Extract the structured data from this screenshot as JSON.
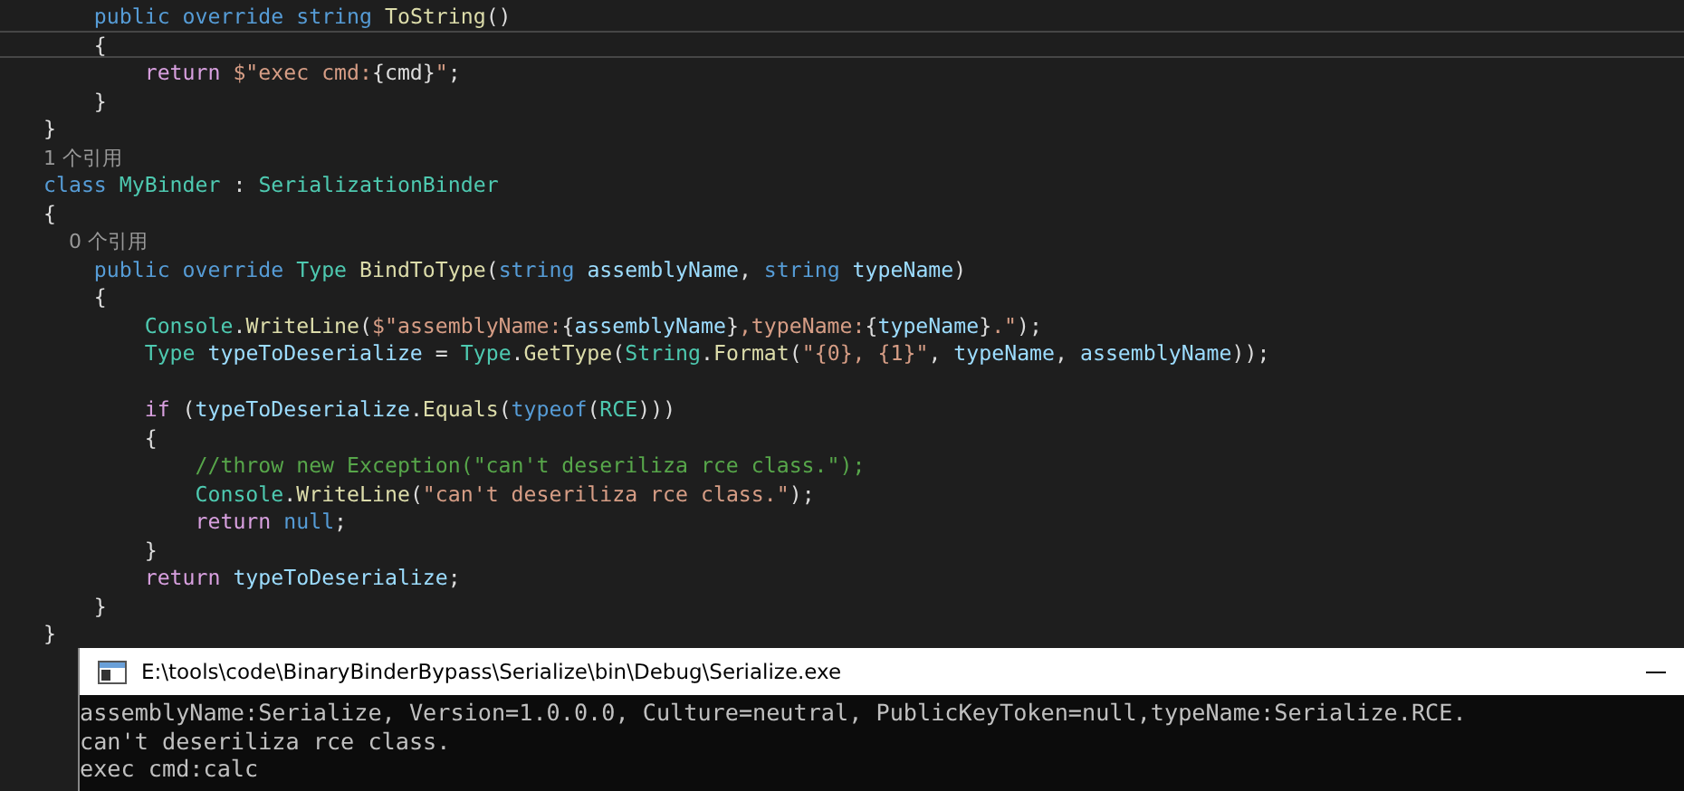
{
  "editor": {
    "lines": [
      {
        "current": false,
        "tokens": [
          {
            "kind": "kw",
            "text": "    public "
          },
          {
            "kind": "kw",
            "text": "override "
          },
          {
            "kind": "kw",
            "text": "string "
          },
          {
            "kind": "method",
            "text": "ToString"
          },
          {
            "kind": "plain",
            "text": "()"
          }
        ]
      },
      {
        "current": true,
        "tokens": [
          {
            "kind": "plain",
            "text": "    {"
          }
        ]
      },
      {
        "current": false,
        "tokens": [
          {
            "kind": "ctrl",
            "text": "        return "
          },
          {
            "kind": "str",
            "text": "$\"exec cmd:"
          },
          {
            "kind": "plain",
            "text": "{cmd}"
          },
          {
            "kind": "str",
            "text": "\""
          },
          {
            "kind": "plain",
            "text": ";"
          }
        ]
      },
      {
        "current": false,
        "tokens": [
          {
            "kind": "plain",
            "text": "    }"
          }
        ]
      },
      {
        "current": false,
        "tokens": [
          {
            "kind": "plain",
            "text": "}"
          }
        ]
      },
      {
        "current": false,
        "tokens": [
          {
            "kind": "lens",
            "text": "1 个引用"
          }
        ]
      },
      {
        "current": false,
        "tokens": [
          {
            "kind": "kw",
            "text": "class "
          },
          {
            "kind": "type",
            "text": "MyBinder"
          },
          {
            "kind": "plain",
            "text": " : "
          },
          {
            "kind": "type",
            "text": "SerializationBinder"
          }
        ]
      },
      {
        "current": false,
        "tokens": [
          {
            "kind": "plain",
            "text": "{"
          }
        ]
      },
      {
        "current": false,
        "tokens": [
          {
            "kind": "lens",
            "text": "    0 个引用"
          }
        ]
      },
      {
        "current": false,
        "tokens": [
          {
            "kind": "kw",
            "text": "    public "
          },
          {
            "kind": "kw",
            "text": "override "
          },
          {
            "kind": "type",
            "text": "Type "
          },
          {
            "kind": "method",
            "text": "BindToType"
          },
          {
            "kind": "plain",
            "text": "("
          },
          {
            "kind": "kw",
            "text": "string "
          },
          {
            "kind": "param",
            "text": "assemblyName"
          },
          {
            "kind": "plain",
            "text": ", "
          },
          {
            "kind": "kw",
            "text": "string "
          },
          {
            "kind": "param",
            "text": "typeName"
          },
          {
            "kind": "plain",
            "text": ")"
          }
        ]
      },
      {
        "current": false,
        "tokens": [
          {
            "kind": "plain",
            "text": "    {"
          }
        ]
      },
      {
        "current": false,
        "tokens": [
          {
            "kind": "type",
            "text": "        Console"
          },
          {
            "kind": "plain",
            "text": "."
          },
          {
            "kind": "method",
            "text": "WriteLine"
          },
          {
            "kind": "plain",
            "text": "("
          },
          {
            "kind": "str",
            "text": "$\"assemblyName:"
          },
          {
            "kind": "plain",
            "text": "{"
          },
          {
            "kind": "param",
            "text": "assemblyName"
          },
          {
            "kind": "plain",
            "text": "}"
          },
          {
            "kind": "str",
            "text": ",typeName:"
          },
          {
            "kind": "plain",
            "text": "{"
          },
          {
            "kind": "param",
            "text": "typeName"
          },
          {
            "kind": "plain",
            "text": "}"
          },
          {
            "kind": "str",
            "text": ".\""
          },
          {
            "kind": "plain",
            "text": ");"
          }
        ]
      },
      {
        "current": false,
        "tokens": [
          {
            "kind": "type",
            "text": "        Type "
          },
          {
            "kind": "param",
            "text": "typeToDeserialize"
          },
          {
            "kind": "plain",
            "text": " = "
          },
          {
            "kind": "type",
            "text": "Type"
          },
          {
            "kind": "plain",
            "text": "."
          },
          {
            "kind": "method",
            "text": "GetType"
          },
          {
            "kind": "plain",
            "text": "("
          },
          {
            "kind": "type",
            "text": "String"
          },
          {
            "kind": "plain",
            "text": "."
          },
          {
            "kind": "method",
            "text": "Format"
          },
          {
            "kind": "plain",
            "text": "("
          },
          {
            "kind": "str",
            "text": "\"{0}, {1}\""
          },
          {
            "kind": "plain",
            "text": ", "
          },
          {
            "kind": "param",
            "text": "typeName"
          },
          {
            "kind": "plain",
            "text": ", "
          },
          {
            "kind": "param",
            "text": "assemblyName"
          },
          {
            "kind": "plain",
            "text": "));"
          }
        ]
      },
      {
        "current": false
      },
      {
        "current": false,
        "tokens": [
          {
            "kind": "ctrl",
            "text": "        if "
          },
          {
            "kind": "plain",
            "text": "("
          },
          {
            "kind": "param",
            "text": "typeToDeserialize"
          },
          {
            "kind": "plain",
            "text": "."
          },
          {
            "kind": "method",
            "text": "Equals"
          },
          {
            "kind": "plain",
            "text": "("
          },
          {
            "kind": "kw",
            "text": "typeof"
          },
          {
            "kind": "plain",
            "text": "("
          },
          {
            "kind": "type",
            "text": "RCE"
          },
          {
            "kind": "plain",
            "text": ")))"
          }
        ]
      },
      {
        "current": false,
        "tokens": [
          {
            "kind": "plain",
            "text": "        {"
          }
        ]
      },
      {
        "current": false,
        "tokens": [
          {
            "kind": "comment",
            "text": "            //throw new Exception(\"can't deseriliza rce class.\");"
          }
        ]
      },
      {
        "current": false,
        "tokens": [
          {
            "kind": "type",
            "text": "            Console"
          },
          {
            "kind": "plain",
            "text": "."
          },
          {
            "kind": "method",
            "text": "WriteLine"
          },
          {
            "kind": "plain",
            "text": "("
          },
          {
            "kind": "str",
            "text": "\"can't deseriliza rce class.\""
          },
          {
            "kind": "plain",
            "text": ");"
          }
        ]
      },
      {
        "current": false,
        "tokens": [
          {
            "kind": "ctrl",
            "text": "            return "
          },
          {
            "kind": "kw",
            "text": "null"
          },
          {
            "kind": "plain",
            "text": ";"
          }
        ]
      },
      {
        "current": false,
        "tokens": [
          {
            "kind": "plain",
            "text": "        }"
          }
        ]
      },
      {
        "current": false,
        "tokens": [
          {
            "kind": "ctrl",
            "text": "        return "
          },
          {
            "kind": "param",
            "text": "typeToDeserialize"
          },
          {
            "kind": "plain",
            "text": ";"
          }
        ]
      },
      {
        "current": false,
        "tokens": [
          {
            "kind": "plain",
            "text": "    }"
          }
        ]
      },
      {
        "current": false,
        "tokens": [
          {
            "kind": "plain",
            "text": "}"
          }
        ]
      }
    ]
  },
  "console": {
    "title": "E:\\tools\\code\\BinaryBinderBypass\\Serialize\\bin\\Debug\\Serialize.exe",
    "lines": [
      "assemblyName:Serialize, Version=1.0.0.0, Culture=neutral, PublicKeyToken=null,typeName:Serialize.RCE.",
      "can't deseriliza rce class.",
      "exec cmd:calc"
    ]
  }
}
